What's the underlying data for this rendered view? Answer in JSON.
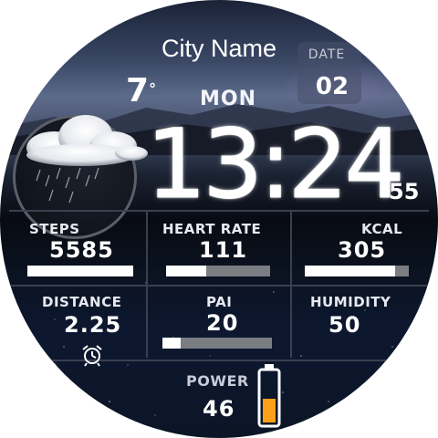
{
  "location": {
    "city": "City Name"
  },
  "weather": {
    "temperature": "7",
    "unit_symbol": "°",
    "condition_icon": "rain-cloud-icon"
  },
  "date": {
    "label": "DATE",
    "day": "02",
    "weekday": "MON"
  },
  "time": {
    "hours_minutes": "13:24",
    "seconds": "55"
  },
  "stats": {
    "steps": {
      "label": "STEPS",
      "value": "5585",
      "progress": 1.0
    },
    "heart_rate": {
      "label": "HEART RATE",
      "value": "111",
      "progress": 0.39
    },
    "kcal": {
      "label": "KCAL",
      "value": "305",
      "progress": 0.87
    },
    "distance": {
      "label": "DISTANCE",
      "value": "2.25",
      "icon": "alarm-clock-icon"
    },
    "pai": {
      "label": "PAI",
      "value": "20",
      "progress": 0.17
    },
    "humidity": {
      "label": "HUMIDITY",
      "value": "50"
    },
    "power": {
      "label": "POWER",
      "value": "46",
      "icon": "battery-icon",
      "level": 0.46
    }
  },
  "colors": {
    "battery_fill": "#ff9f1a",
    "bar_track": "#7a7d82",
    "bar_fill": "#ffffff"
  }
}
